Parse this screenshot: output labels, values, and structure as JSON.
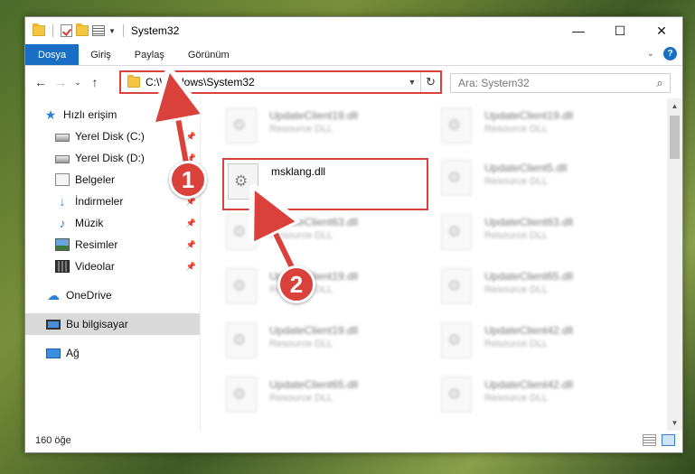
{
  "window": {
    "title": "System32",
    "controls": {
      "minimize": "—",
      "maximize": "☐",
      "close": "✕"
    }
  },
  "ribbon": {
    "tabs": [
      "Dosya",
      "Giriş",
      "Paylaş",
      "Görünüm"
    ],
    "help": "?"
  },
  "nav": {
    "back": "←",
    "forward": "→",
    "recent": "⌄",
    "up": "↑",
    "address": "C:\\Windows\\System32",
    "search_placeholder": "Ara: System32"
  },
  "sidebar": {
    "items": [
      {
        "label": "Hızlı erişim",
        "icon": "star-icon"
      },
      {
        "label": "Yerel Disk (C:)",
        "icon": "disk-icon",
        "pinned": true
      },
      {
        "label": "Yerel Disk (D:)",
        "icon": "disk-icon",
        "pinned": true
      },
      {
        "label": "Belgeler",
        "icon": "documents-icon",
        "pinned": true
      },
      {
        "label": "İndirmeler",
        "icon": "download-icon",
        "pinned": true
      },
      {
        "label": "Müzik",
        "icon": "music-icon",
        "pinned": true
      },
      {
        "label": "Resimler",
        "icon": "pictures-icon",
        "pinned": true
      },
      {
        "label": "Videolar",
        "icon": "videos-icon",
        "pinned": true
      },
      {
        "label": "OneDrive",
        "icon": "cloud-icon"
      },
      {
        "label": "Bu bilgisayar",
        "icon": "computer-icon",
        "selected": true
      },
      {
        "label": "Ağ",
        "icon": "network-icon"
      }
    ]
  },
  "files": {
    "highlighted": {
      "name": "msklang.dll",
      "description": ""
    },
    "background": [
      {
        "name": "UpdateClient19.dll",
        "description": "Resource DLL"
      },
      {
        "name": "UpdateClient19.dll",
        "description": "Resource DLL"
      },
      {
        "name": "UpdateClient5.dll",
        "description": "Resource DLL"
      },
      {
        "name": "UpdateClient63.dll",
        "description": "Resource DLL"
      },
      {
        "name": "UpdateClient63.dll",
        "description": "Resource DLL"
      },
      {
        "name": "UpdateClient19.dll",
        "description": "Resource DLL"
      },
      {
        "name": "UpdateClient65.dll",
        "description": "Resource DLL"
      },
      {
        "name": "UpdateClient19.dll",
        "description": "Resource DLL"
      },
      {
        "name": "UpdateClient42.dll",
        "description": "Resource DLL"
      },
      {
        "name": "UpdateClient65.dll",
        "description": "Resource DLL"
      },
      {
        "name": "UpdateClient42.dll",
        "description": "Resource DLL"
      }
    ]
  },
  "status": {
    "item_count": "160 öğe"
  },
  "annotations": {
    "step1": "1",
    "step2": "2",
    "color": "#d9413a"
  }
}
